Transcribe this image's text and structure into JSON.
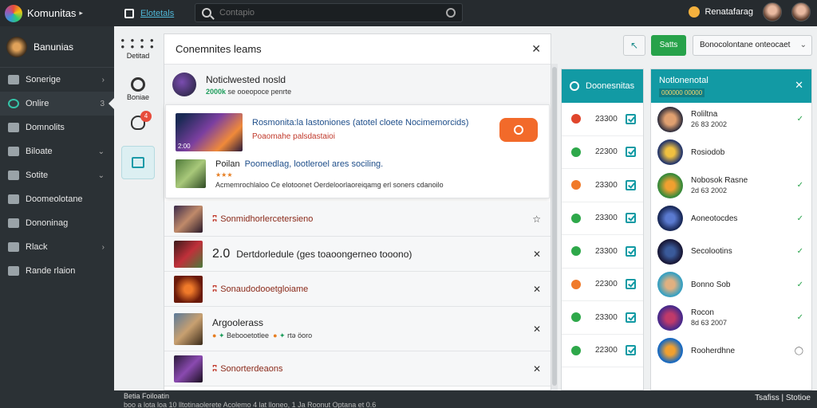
{
  "app": {
    "name": "Komunitas",
    "tab": "Elotetals"
  },
  "search": {
    "placeholder": "Contapio"
  },
  "user": {
    "name": "Renatafarag"
  },
  "sidebar": {
    "profile": "Banunias",
    "items": [
      {
        "label": "Sonerige",
        "chev": "›"
      },
      {
        "label": "Onlire",
        "chev": "3"
      },
      {
        "label": "Domnolits",
        "chev": ""
      },
      {
        "label": "Biloate",
        "chev": "⌄"
      },
      {
        "label": "Sotite",
        "chev": "⌄"
      },
      {
        "label": "Doomeolotane",
        "chev": ""
      },
      {
        "label": "Dononinag",
        "chev": ""
      },
      {
        "label": "Rlack",
        "chev": "›"
      },
      {
        "label": "Rande rlaion",
        "chev": ""
      }
    ]
  },
  "rail": {
    "top_label": "Detitad",
    "gear_label": "Boniae",
    "badge": "4"
  },
  "main": {
    "title": "Conemnites leams",
    "notif": {
      "title": "Noticlwested nosld",
      "sub_bold": "2000k",
      "sub": "se ooeopoce penrte"
    },
    "featured": {
      "title": "Rosmonita:la lastoniones (atotel cloete Nocimemorcids)",
      "sub": "Poaomahe palsdastaioi",
      "img_label": "2:00",
      "item2_title": "Poilan",
      "item2_blue": "Poomedlag, lootleroel ares sociling.",
      "item2_stars": "★★★",
      "item2_desc": "Acmemrochlaloo Ce elotoonet Oerdeloorlaoreiqamg erl soners cdanoilo"
    },
    "list": [
      {
        "pre": "ʭ",
        "text": "Sonmidhorlercetersieno",
        "act": "☆"
      },
      {
        "num": "2.0",
        "text": "Dertdorledule (ges toaoongerneo tooono)",
        "act": "✕"
      },
      {
        "pre": "ʭ",
        "text": "Sonaudodooetgloiame",
        "act": "✕"
      },
      {
        "text": "Argoolerass",
        "tag1": "Bebooetotlee",
        "tag2": "rtə öoro",
        "act": "✕"
      },
      {
        "pre": "ʭ",
        "text": "Sonorterdeaons",
        "act": "✕"
      }
    ]
  },
  "toolbar": {
    "back": "↖",
    "save": "Satts",
    "select": "Bonocolontane onteocaet"
  },
  "downloads": {
    "title": "Doonesnitas",
    "rows": [
      {
        "v": "23300",
        "color": "#e0452b"
      },
      {
        "v": "22300",
        "color": "#2ea84a"
      },
      {
        "v": "23300",
        "color": "#f07a2a"
      },
      {
        "v": "23300",
        "color": "#2ea84a"
      },
      {
        "v": "23300",
        "color": "#2ea84a"
      },
      {
        "v": "22300",
        "color": "#f07a2a"
      },
      {
        "v": "23300",
        "color": "#2ea84a"
      },
      {
        "v": "22300",
        "color": "#2ea84a"
      }
    ]
  },
  "notifications": {
    "title": "Notlonenotal",
    "sub": "000000 00000",
    "rows": [
      {
        "name": "Roliltna",
        "date": "26 83 2002",
        "status": "✓"
      },
      {
        "name": "Rosiodob",
        "date": "",
        "status": ""
      },
      {
        "name": "Nobosok Rasne",
        "date": "2d 63 2002",
        "status": "✓"
      },
      {
        "name": "Aoneotocdes",
        "date": "",
        "status": "✓"
      },
      {
        "name": "Secolootins",
        "date": "",
        "status": "✓"
      },
      {
        "name": "Bonno Sob",
        "date": "",
        "status": "✓"
      },
      {
        "name": "Rocon",
        "date": "8d 63 2007",
        "status": "✓"
      },
      {
        "name": "Rooherdhne",
        "date": "",
        "status": "◯"
      }
    ]
  },
  "status": {
    "line1": "Betia Foiloatin",
    "line2": "boo a lota loa 10 lltotinaolerete Acolemo 4 lat lloneo, 1 Ja Roonut Optana et 0.6",
    "right": "Tsafiss | Stotioe"
  }
}
